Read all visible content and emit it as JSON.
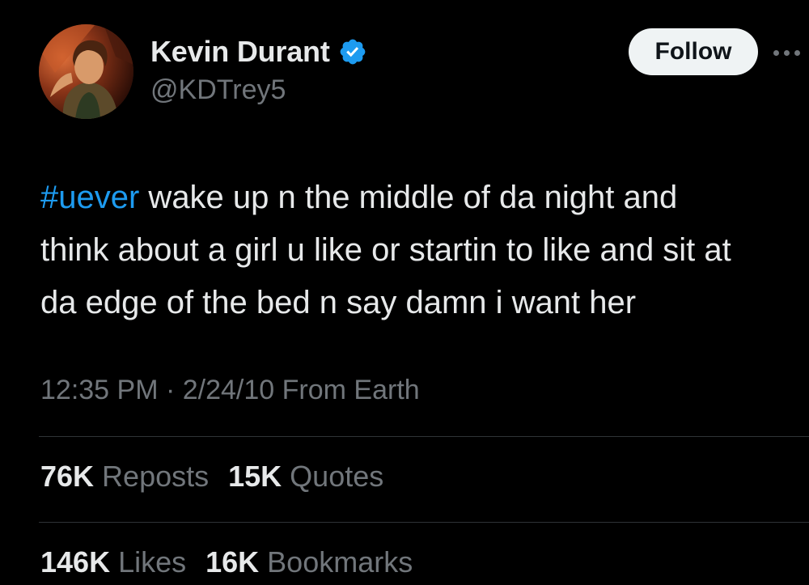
{
  "author": {
    "display_name": "Kevin Durant",
    "handle": "@KDTrey5",
    "verified_icon": "verified-badge-icon"
  },
  "actions": {
    "follow_label": "Follow",
    "more_icon": "more-options-icon"
  },
  "tweet": {
    "hashtag": "#uever",
    "text_line1_rest": " wake up n the middle of da night and",
    "text_line2": "think about a girl u like or startin to like and sit at",
    "text_line3": "da edge of the bed n say damn i want her"
  },
  "meta": {
    "time": "12:35 PM",
    "separator": " · ",
    "date": "2/24/10",
    "source": " From Earth"
  },
  "stats": {
    "reposts_count": "76K",
    "reposts_label": "Reposts",
    "quotes_count": "15K",
    "quotes_label": "Quotes",
    "likes_count": "146K",
    "likes_label": "Likes",
    "bookmarks_count": "16K",
    "bookmarks_label": "Bookmarks"
  },
  "colors": {
    "background": "#000000",
    "text_primary": "#e7e9ea",
    "text_secondary": "#71767b",
    "accent": "#1d9bf0",
    "follow_bg": "#eff3f4",
    "divider": "#2f3336"
  }
}
